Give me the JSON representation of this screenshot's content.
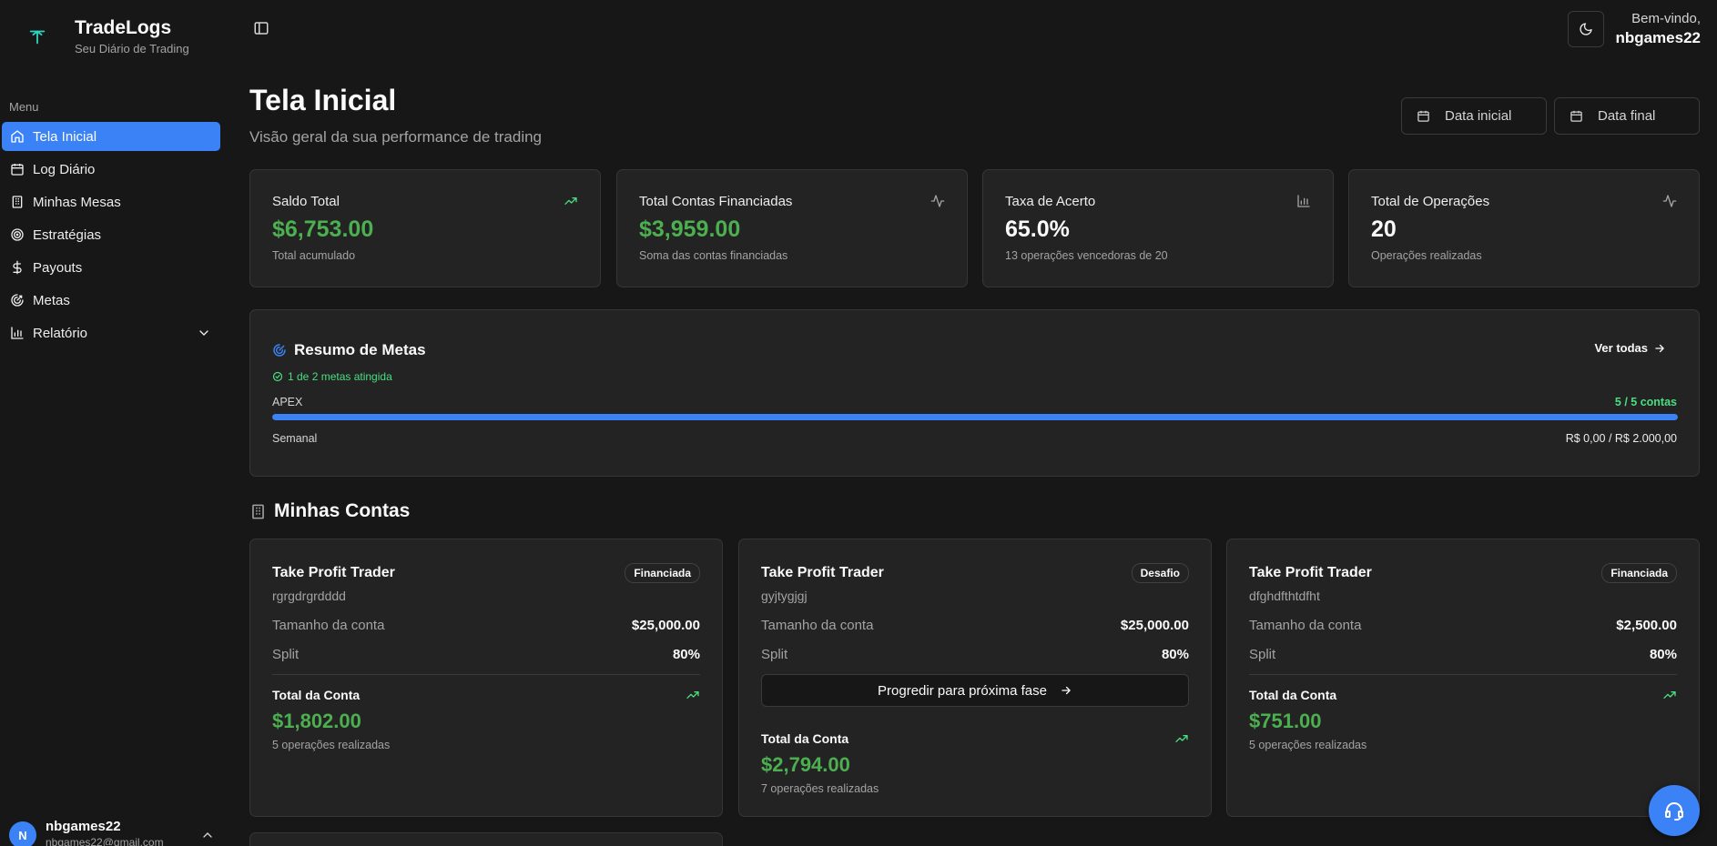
{
  "brand": {
    "name": "TradeLogs",
    "subtitle": "Seu Diário de Trading"
  },
  "sidebar": {
    "menu_label": "Menu",
    "items": [
      {
        "label": "Tela Inicial",
        "icon": "home-icon",
        "active": true
      },
      {
        "label": "Log Diário",
        "icon": "calendar-icon"
      },
      {
        "label": "Minhas Mesas",
        "icon": "building-icon"
      },
      {
        "label": "Estratégias",
        "icon": "target-icon"
      },
      {
        "label": "Payouts",
        "icon": "dollar-icon"
      },
      {
        "label": "Metas",
        "icon": "goal-icon"
      },
      {
        "label": "Relatório",
        "icon": "bar-chart-icon",
        "expandable": true
      }
    ],
    "user": {
      "initial": "N",
      "name": "nbgames22",
      "email": "nbgames22@gmail.com"
    }
  },
  "header": {
    "welcome": "Bem-vindo,",
    "username": "nbgames22"
  },
  "page": {
    "title": "Tela Inicial",
    "subtitle": "Visão geral da sua performance de trading",
    "date_start": "Data inicial",
    "date_end": "Data final"
  },
  "stats": [
    {
      "label": "Saldo Total",
      "value": "$6,753.00",
      "note": "Total acumulado",
      "icon": "trending-up-icon"
    },
    {
      "label": "Total Contas Financiadas",
      "value": "$3,959.00",
      "note": "Soma das contas financiadas",
      "icon": "activity-icon"
    },
    {
      "label": "Taxa de Acerto",
      "value": "65.0%",
      "note": "13 operações vencedoras de 20",
      "icon": "bar-chart-icon"
    },
    {
      "label": "Total de Operações",
      "value": "20",
      "note": "Operações realizadas",
      "icon": "activity-icon"
    }
  ],
  "goals": {
    "title": "Resumo de Metas",
    "see_all": "Ver todas",
    "status": "1 de 2 metas atingida",
    "item": {
      "name": "APEX",
      "count": "5 / 5 contas",
      "progress": 1.0,
      "period": "Semanal",
      "amount": "R$ 0,00 / R$ 2.000,00"
    }
  },
  "accounts": {
    "title": "Minhas Contas",
    "size_label": "Tamanho da conta",
    "split_label": "Split",
    "total_label": "Total da Conta",
    "items": [
      {
        "firm": "Take Profit Trader",
        "id": "rgrgdrgrdddd",
        "badge": "Financiada",
        "size": "$25,000.00",
        "split": "80%",
        "total": "$1,802.00",
        "ops": "5 operações realizadas"
      },
      {
        "firm": "Take Profit Trader",
        "id": "gyjtygjgj",
        "badge": "Desafio",
        "size": "$25,000.00",
        "split": "80%",
        "action": "Progredir para próxima fase",
        "total": "$2,794.00",
        "ops": "7 operações realizadas"
      },
      {
        "firm": "Take Profit Trader",
        "id": "dfghdfthtdfht",
        "badge": "Financiada",
        "size": "$2,500.00",
        "split": "80%",
        "total": "$751.00",
        "ops": "5 operações realizadas"
      }
    ]
  },
  "colors": {
    "accent": "#3b82f6",
    "positive": "#4ade80",
    "background": "#171717",
    "card": "#232323"
  }
}
